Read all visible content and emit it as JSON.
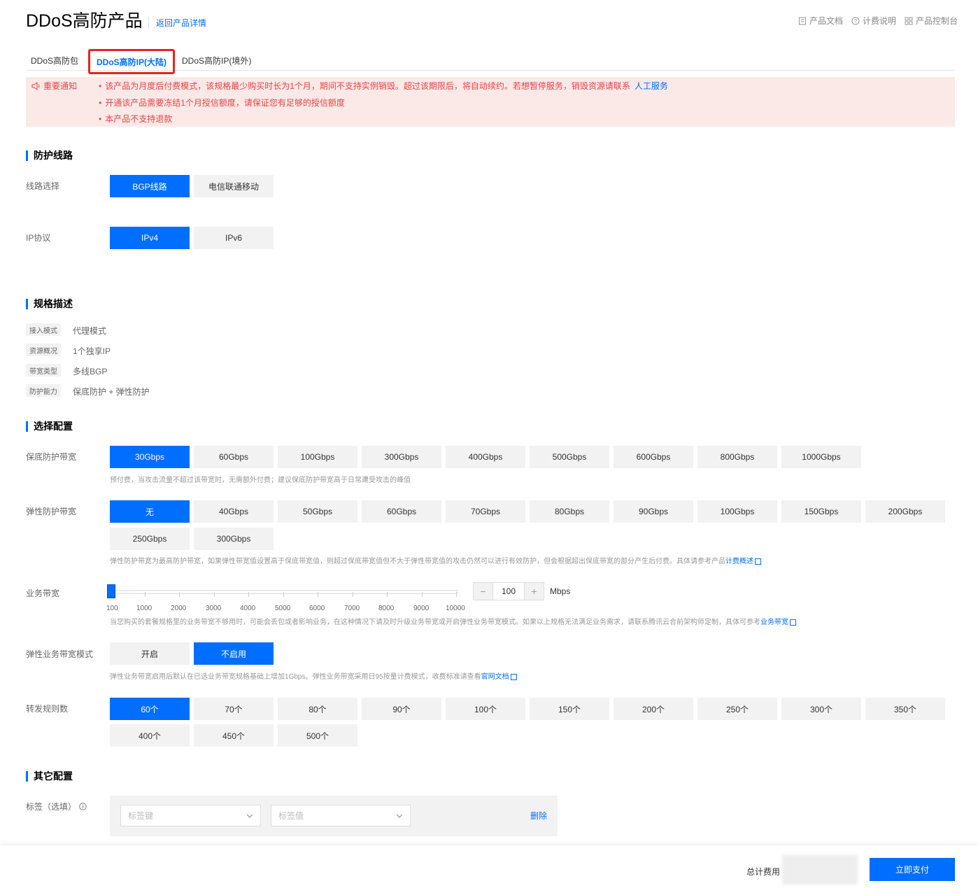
{
  "header": {
    "title": "DDoS高防产品",
    "back_link": "返回产品详情",
    "links": [
      "产品文档",
      "计费说明",
      "产品控制台"
    ]
  },
  "tabs": [
    "DDoS高防包",
    "DDoS高防IP(大陆)",
    "DDoS高防IP(境外)"
  ],
  "notice": {
    "title": "重要通知",
    "items": [
      "该产品为月度后付费模式，该规格最少购买时长为1个月，期间不支持实例销毁。超过该期限后，将自动续约。若想暂停服务，销毁资源请联系",
      "开通该产品需要冻结1个月授信额度，请保证您有足够的授信额度",
      "本产品不支持退款"
    ],
    "link": "人工服务"
  },
  "line": {
    "section": "防护线路",
    "route_label": "线路选择",
    "routes": [
      "BGP线路",
      "电信联通移动"
    ],
    "ip_label": "IP协议",
    "ip_options": [
      "IPv4",
      "IPv6"
    ]
  },
  "spec": {
    "section": "规格描述",
    "rows": [
      {
        "k": "接入模式",
        "v": "代理模式"
      },
      {
        "k": "资源概况",
        "v": "1个独享IP"
      },
      {
        "k": "带宽类型",
        "v": "多线BGP"
      },
      {
        "k": "防护能力",
        "v": "保底防护 + 弹性防护"
      }
    ]
  },
  "config": {
    "section": "选择配置",
    "base_label": "保底防护带宽",
    "base_options": [
      "30Gbps",
      "60Gbps",
      "100Gbps",
      "300Gbps",
      "400Gbps",
      "500Gbps",
      "600Gbps",
      "800Gbps",
      "1000Gbps"
    ],
    "base_hint": "预付费，当攻击流量不超过该带宽时，无需额外付费；建议保底防护带宽高于日常遭受攻击的峰值",
    "elastic_label": "弹性防护带宽",
    "elastic_options": [
      "无",
      "40Gbps",
      "50Gbps",
      "60Gbps",
      "70Gbps",
      "80Gbps",
      "90Gbps",
      "100Gbps",
      "150Gbps",
      "200Gbps",
      "250Gbps",
      "300Gbps"
    ],
    "elastic_hint": "弹性防护带宽为最高防护带宽，如果弹性带宽值设置高于保底带宽值，则超过保底带宽值但不大于弹性带宽值的攻击仍然可以进行有效防护，但会根据超出保底带宽的部分产生后付费。具体请参考产品",
    "elastic_hint_link": "计费概述",
    "biz_label": "业务带宽",
    "biz_ticks": [
      "100",
      "1000",
      "2000",
      "3000",
      "4000",
      "5000",
      "6000",
      "7000",
      "8000",
      "9000",
      "10000"
    ],
    "biz_value": "100",
    "biz_unit": "Mbps",
    "biz_hint": "当您购买的套餐规格里的业务带宽不够用时，可能会丢包或者影响业务，在这种情况下请及时升级业务带宽或开启弹性业务带宽模式。如果以上规格无法满足业务需求，请联系腾讯云合前架构师定制，具体可参考",
    "biz_hint_link": "业务带宽",
    "elastic_mode_label": "弹性业务带宽模式",
    "elastic_mode_options": [
      "开启",
      "不启用"
    ],
    "elastic_mode_hint": "弹性业务带宽启用后默认在已选业务带宽规格基础上增加1Gbps。弹性业务带宽采用日95按量计费模式，收费标准请查看",
    "elastic_mode_hint_link": "官网文档",
    "rules_label": "转发规则数",
    "rules_options": [
      "60个",
      "70个",
      "80个",
      "90个",
      "100个",
      "150个",
      "200个",
      "250个",
      "300个",
      "350个",
      "400个",
      "450个",
      "500个"
    ]
  },
  "other": {
    "section": "其它配置",
    "tag_label": "标签（选填）",
    "tag_key_placeholder": "标签键",
    "tag_value_placeholder": "标签值",
    "tag_delete": "删除"
  },
  "footer": {
    "total_label": "总计费用",
    "pay_button": "立即支付"
  },
  "colors": {
    "accent": "#006eff",
    "notice_bg": "#fbe9e8",
    "notice_text": "#e54545",
    "highlight": "#e5251e"
  }
}
